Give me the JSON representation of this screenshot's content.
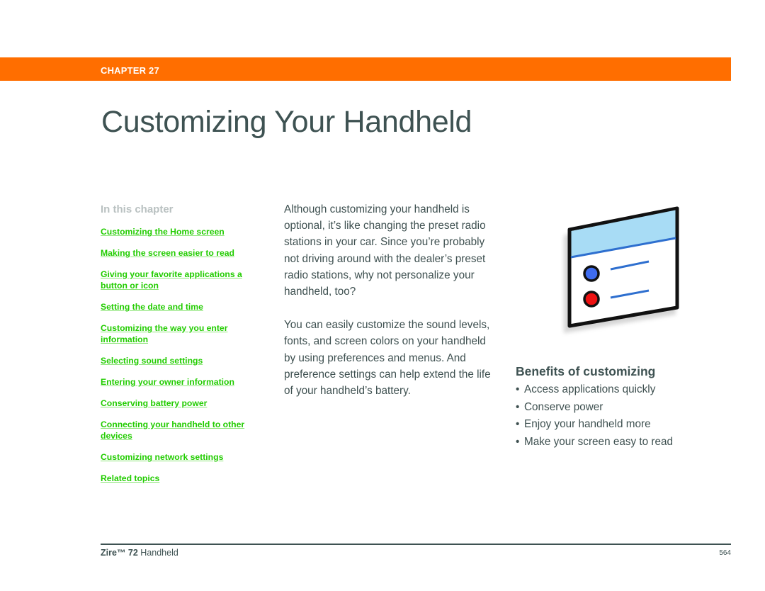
{
  "header": {
    "chapter_label": "CHAPTER 27",
    "title": "Customizing Your Handheld"
  },
  "toc": {
    "heading": "In this chapter",
    "items": [
      {
        "label": "Customizing the Home screen"
      },
      {
        "label": "Making the screen easier to read"
      },
      {
        "label": "Giving your favorite applications a button or icon"
      },
      {
        "label": "Setting the date and time"
      },
      {
        "label": "Customizing the way you enter information"
      },
      {
        "label": "Selecting sound settings"
      },
      {
        "label": "Entering your owner information"
      },
      {
        "label": "Conserving battery power"
      },
      {
        "label": "Connecting your handheld to other devices"
      },
      {
        "label": "Customizing network settings"
      },
      {
        "label": "Related topics"
      }
    ]
  },
  "intro": {
    "paragraphs": [
      "Although customizing your handheld is optional, it’s like changing the preset radio stations in your car. Since you’re probably not driving around with the dealer’s preset radio stations, why not personalize your handheld, too?",
      "You can easily customize the sound levels, fonts, and screen colors on your handheld by using preferences and menus. And preference settings can help extend the life of your handheld’s battery."
    ]
  },
  "illustration": {
    "icon": "preferences-window-icon",
    "colors": {
      "title_bar": "#a8dcf5",
      "accent_line": "#2e6fcf",
      "dot_blue": "#3e6cf0",
      "dot_red": "#ee1111",
      "frame": "#111111"
    }
  },
  "benefits": {
    "heading": "Benefits of customizing",
    "bullet": "•",
    "items": [
      "Access applications quickly",
      "Conserve power",
      "Enjoy your handheld more",
      "Make your screen easy to read"
    ]
  },
  "footer": {
    "product_brand": "Zire™ 72",
    "product_suffix": " Handheld",
    "page_number": "564"
  },
  "colors": {
    "chapter_bar": "#ff6e00",
    "link": "#22cc00",
    "text": "#3e5050",
    "toc_heading": "#b9c1c1"
  }
}
